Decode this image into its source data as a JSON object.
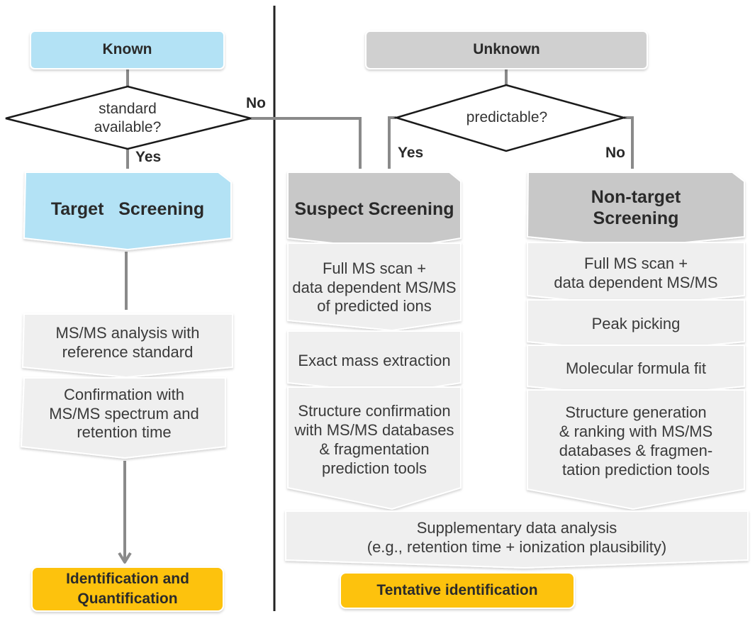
{
  "colors": {
    "known_fill": "#b3e2f5",
    "unknown_fill": "#d0d0d0",
    "screening_gray": "#c8c8c8",
    "step_fill": "#efefef",
    "result_fill": "#fdc20e",
    "connector": "#8a8a8a",
    "divider": "#222222"
  },
  "left": {
    "start": "Known",
    "decision": "standard\navailable?",
    "yes_label": "Yes",
    "no_label": "No",
    "screening": "Target   Screening",
    "steps": [
      "MS/MS analysis with\nreference standard",
      "Confirmation with\nMS/MS spectrum and\nretention time"
    ],
    "result": "Identification and\nQuantification"
  },
  "right": {
    "start": "Unknown",
    "decision": "predictable?",
    "yes_label": "Yes",
    "no_label": "No",
    "suspect": {
      "title": "Suspect Screening",
      "steps": [
        "Full MS scan +\ndata dependent MS/MS\nof predicted ions",
        "Exact mass extraction",
        "Structure confirmation\nwith MS/MS databases\n& fragmentation\nprediction tools"
      ]
    },
    "nontarget": {
      "title": "Non-target\nScreening",
      "steps": [
        "Full MS scan +\ndata dependent MS/MS",
        "Peak picking",
        "Molecular formula fit",
        "Structure generation\n& ranking with MS/MS\ndatabases & fragmen-\ntation prediction tools"
      ]
    },
    "supplementary": "Supplementary data analysis\n(e.g., retention time + ionization plausibility)",
    "result": "Tentative identification"
  }
}
